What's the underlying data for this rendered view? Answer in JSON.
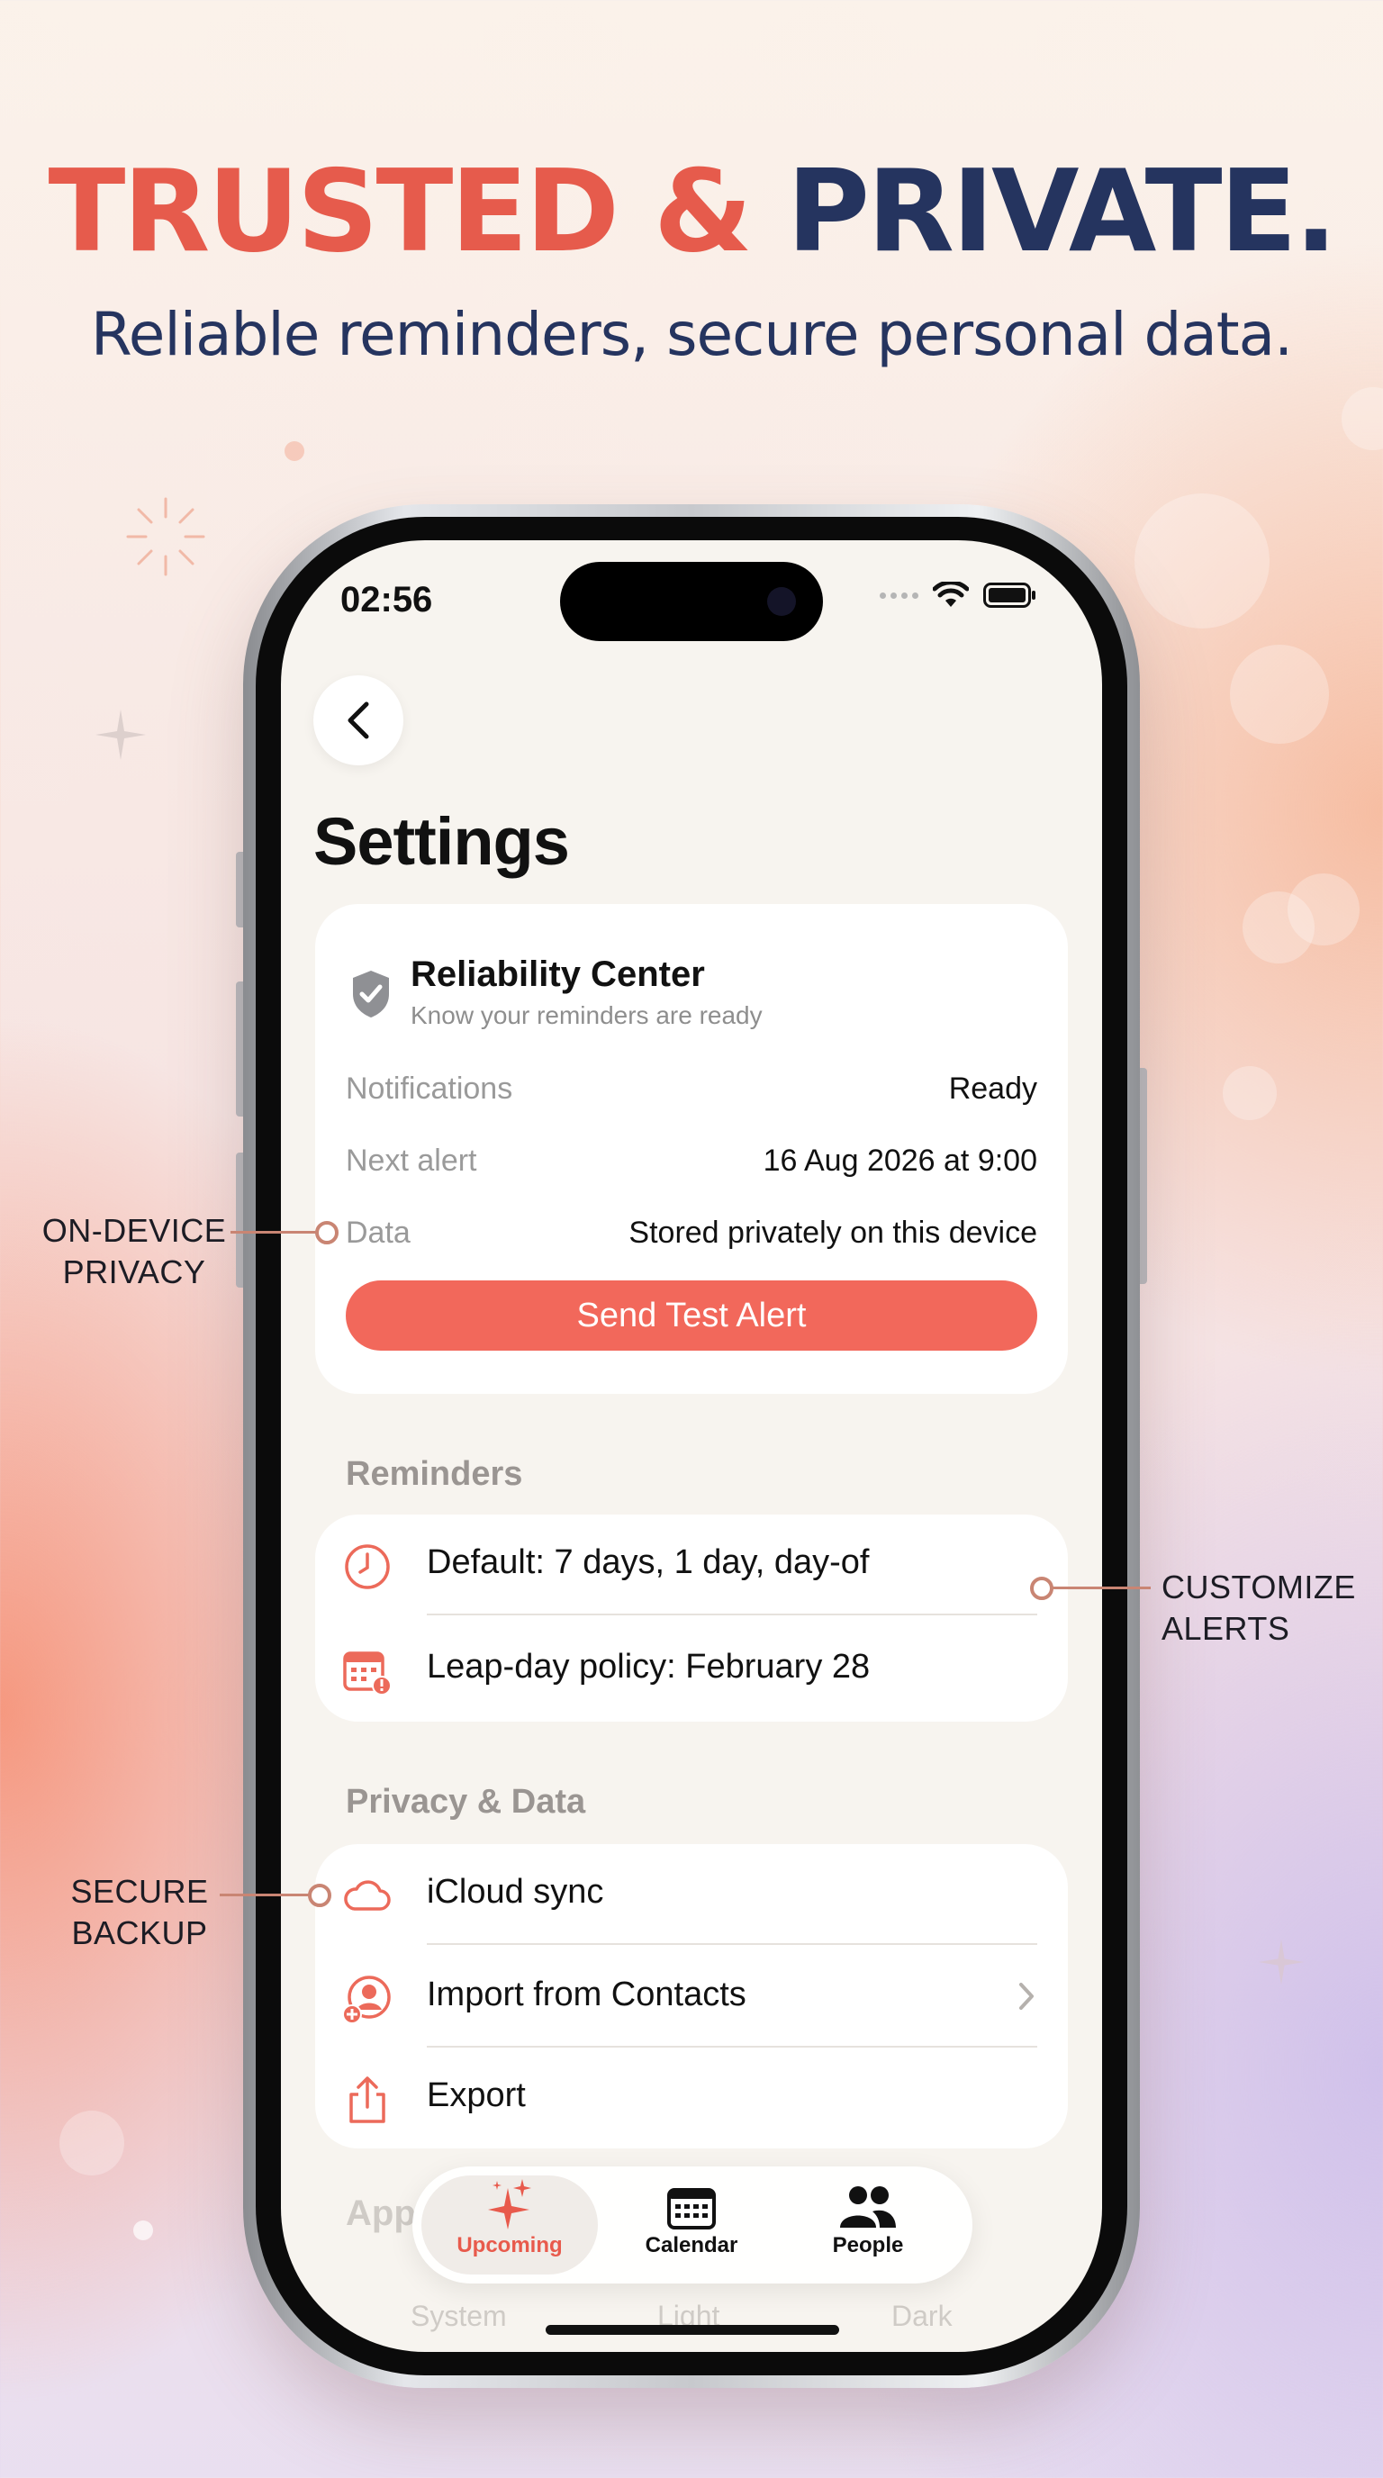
{
  "headline": {
    "part1": "TRUSTED &",
    "part2": "PRIVATE."
  },
  "subheadline": "Reliable reminders, secure personal data.",
  "status_bar": {
    "time": "02:56"
  },
  "page_title": "Settings",
  "reliability_center": {
    "title": "Reliability Center",
    "subtitle": "Know your reminders are ready",
    "rows": [
      {
        "key": "Notifications",
        "value": "Ready"
      },
      {
        "key": "Next alert",
        "value": "16 Aug 2026 at 9:00"
      },
      {
        "key": "Data",
        "value": "Stored privately on this device"
      }
    ],
    "button_label": "Send Test Alert"
  },
  "reminders": {
    "header": "Reminders",
    "items": [
      {
        "label": "Default: 7 days, 1 day, day-of",
        "icon": "clock-icon"
      },
      {
        "label": "Leap-day policy: February 28",
        "icon": "calendar-alert-icon"
      }
    ]
  },
  "privacy": {
    "header": "Privacy & Data",
    "items": [
      {
        "label": "iCloud sync",
        "icon": "cloud-icon"
      },
      {
        "label": "Import from Contacts",
        "icon": "contact-add-icon"
      },
      {
        "label": "Export",
        "icon": "share-icon"
      }
    ]
  },
  "appearance": {
    "header": "App",
    "options": [
      "System",
      "Light",
      "Dark"
    ]
  },
  "tabbar": {
    "tabs": [
      {
        "label": "Upcoming"
      },
      {
        "label": "Calendar"
      },
      {
        "label": "People"
      }
    ]
  },
  "callouts": {
    "on_device": [
      "ON-DEVICE",
      "PRIVACY"
    ],
    "customize": [
      "CUSTOMIZE",
      "ALERTS"
    ],
    "backup": [
      "SECURE",
      "BACKUP"
    ]
  },
  "colors": {
    "accent": "#f2685b",
    "headline_red": "#e65b4c",
    "headline_navy": "#25345f"
  }
}
